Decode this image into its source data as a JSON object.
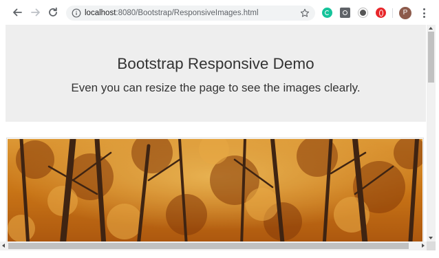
{
  "browser": {
    "url_host": "localhost",
    "url_rest": ":8080/Bootstrap/ResponsiveImages.html",
    "profile_initial": "P",
    "icons": {
      "back": "back-arrow-icon",
      "forward": "forward-arrow-icon",
      "reload": "reload-icon",
      "info": "info-icon",
      "bookmark": "star-icon",
      "menu": "kebab-menu-icon"
    },
    "extensions": [
      "grammarly-icon",
      "camera-icon",
      "circle-extension-icon",
      "opera-icon"
    ]
  },
  "page": {
    "heading": "Bootstrap Responsive Demo",
    "subtitle": "Even you can resize the page to see the images clearly.",
    "image": {
      "subject": "autumn forest trees",
      "colors": [
        "#c56a10",
        "#e79a2a",
        "#4a2e1a"
      ]
    },
    "jumbotron_color": "#eeeeee"
  }
}
